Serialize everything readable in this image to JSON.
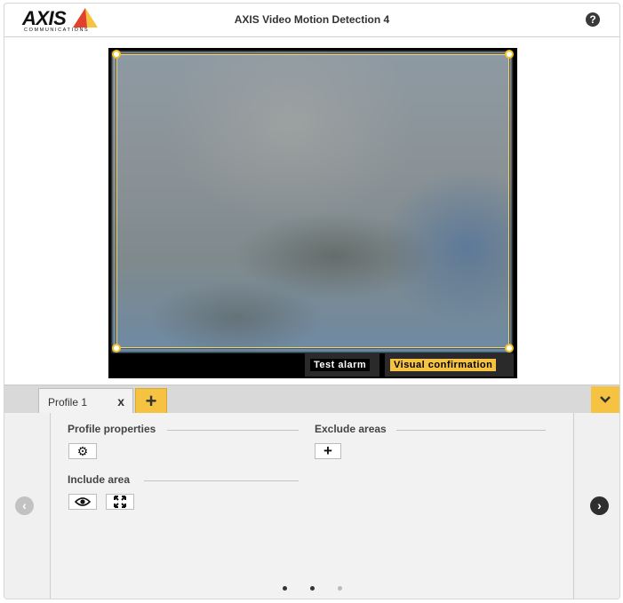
{
  "header": {
    "logo_text": "AXIS",
    "logo_sub": "COMMUNICATIONS",
    "title": "AXIS Video Motion Detection 4",
    "help_icon": "?"
  },
  "video": {
    "test_alarm_label": "Test alarm",
    "visual_confirmation_label": "Visual confirmation"
  },
  "tabs": {
    "items": [
      {
        "label": "Profile 1",
        "close": "x"
      }
    ],
    "add_icon": "+",
    "collapse_icon": "⌄"
  },
  "panel": {
    "profile_properties_title": "Profile properties",
    "include_area_title": "Include area",
    "exclude_areas_title": "Exclude areas",
    "settings_icon": "⚙",
    "view_icon": "👁",
    "expand_icon": "⤢",
    "add_exclude_icon": "+",
    "prev_icon": "‹",
    "next_icon": "›",
    "pages": {
      "count": 3,
      "active": 1
    }
  },
  "colors": {
    "accent": "#f5c242",
    "roi_border": "#f5d46a"
  }
}
